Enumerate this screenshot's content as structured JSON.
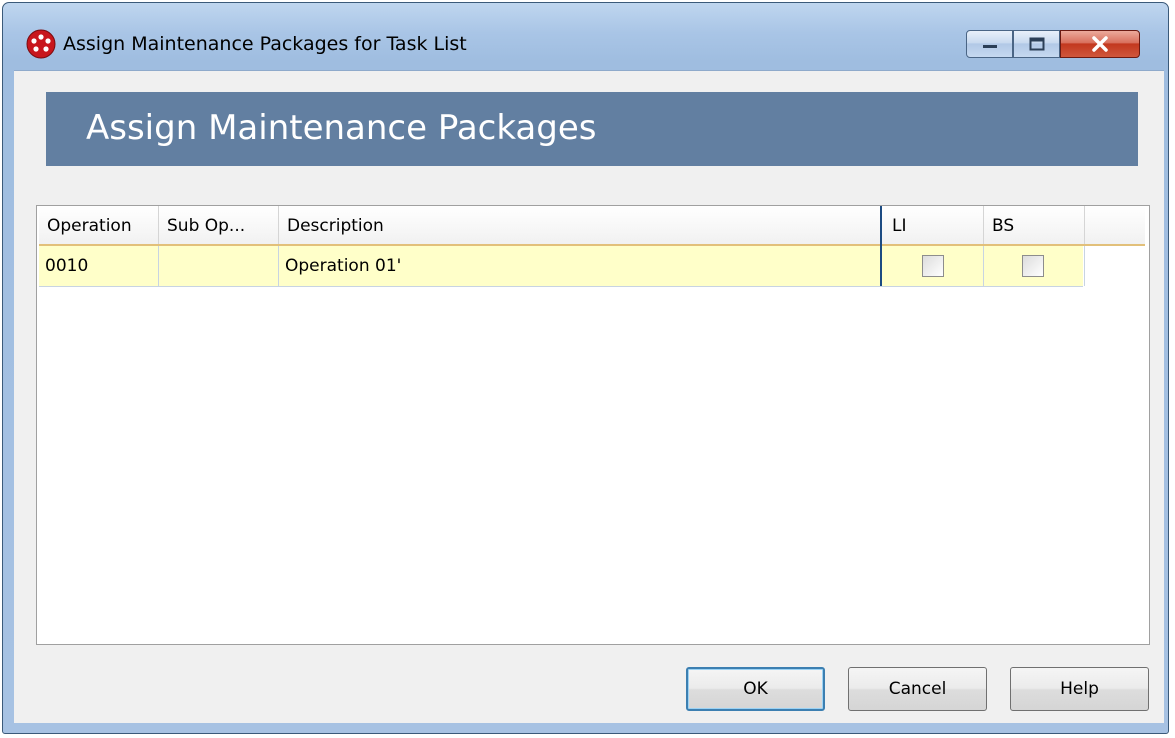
{
  "window": {
    "title": "Assign Maintenance Packages for Task List",
    "controls": {
      "minimize": "minimize-icon",
      "maximize": "maximize-icon",
      "close": "close-icon"
    }
  },
  "banner": {
    "title": "Assign Maintenance Packages"
  },
  "grid": {
    "columns": [
      "Operation",
      "Sub Op...",
      "Description",
      "LI",
      "BS"
    ],
    "rows": [
      {
        "operation": "0010",
        "sub_op": "",
        "description": "Operation 01'",
        "li_checked": false,
        "bs_checked": false
      }
    ]
  },
  "buttons": {
    "ok": "OK",
    "cancel": "Cancel",
    "help": "Help"
  },
  "colors": {
    "banner": "#627fa1",
    "row_highlight": "#ffffc9",
    "header_accent": "#e2c07a"
  }
}
